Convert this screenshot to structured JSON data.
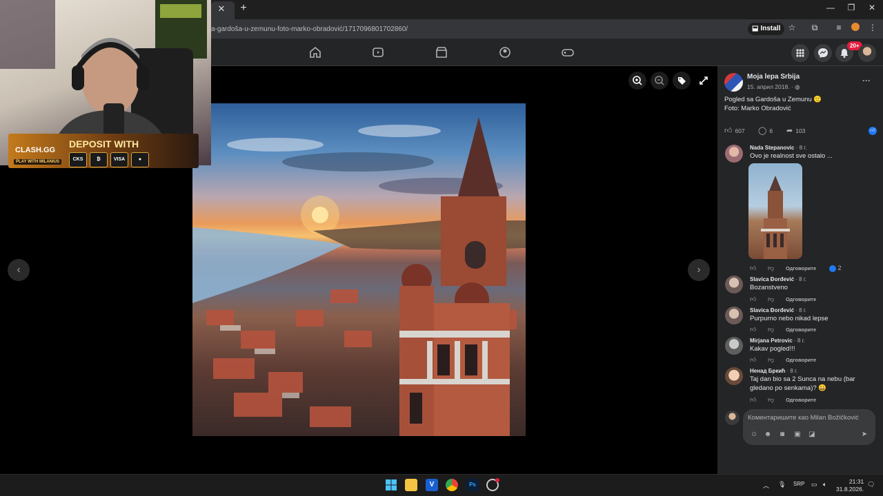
{
  "browser": {
    "tab_close": "✕",
    "new_tab": "+",
    "url": "a-gardoša-u-zemunu-foto-marko-obradović/1717096801702860/",
    "install_label": "Install",
    "win_min": "—",
    "win_restore": "❐",
    "win_close": "✕"
  },
  "facebook": {
    "notif_count": "20+",
    "nav_icons": [
      "home-icon",
      "video-icon",
      "marketplace-icon",
      "groups-icon",
      "gaming-icon"
    ]
  },
  "stream_overlay": {
    "brand": "CLASH.GG",
    "sub": "PLAY WITH MILANIUS",
    "title": "DEPOSIT WITH",
    "payments": [
      "CKS",
      "₿",
      "VISA",
      "●"
    ]
  },
  "post": {
    "page_name": "Moja lepa Srbija",
    "date": "15. април 2018. · ◍",
    "text_line1": "Pogled sa Gardoša u Zemunu 🙂",
    "text_line2": "Foto: Marko Obradović",
    "likes": "607",
    "comments": "6",
    "shares": "103"
  },
  "comments": [
    {
      "name": "Nada Stepanovic",
      "age": " · 8 г.",
      "text": "Ovo je realnost sve ostalo ...",
      "reply": "Одговорите",
      "reactions": "2"
    },
    {
      "name": "Slavica Đorđević",
      "age": " · 8 г.",
      "text": "Bozanstveno",
      "reply": "Одговорите"
    },
    {
      "name": "Slavica Đorđević",
      "age": " · 8 г.",
      "text": "Purpurno nebo nikad lepse",
      "reply": "Одговорите"
    },
    {
      "name": "Mirjana Petrovic",
      "age": " · 8 г.",
      "text": "Kakav pogled!!!",
      "reply": "Одговорите"
    },
    {
      "name": "Ненад Бркић",
      "age": " · 8 г.",
      "text": "Taj dan bio sa 2 Sunca na nebu (bar gledano po senkama)? 😀",
      "reply": "Одговорите"
    }
  ],
  "composer": {
    "placeholder": "Коментаришите као Milan Božičković"
  },
  "taskbar": {
    "lang": "SRP",
    "time": "21:31",
    "date": "31.8.2026."
  }
}
